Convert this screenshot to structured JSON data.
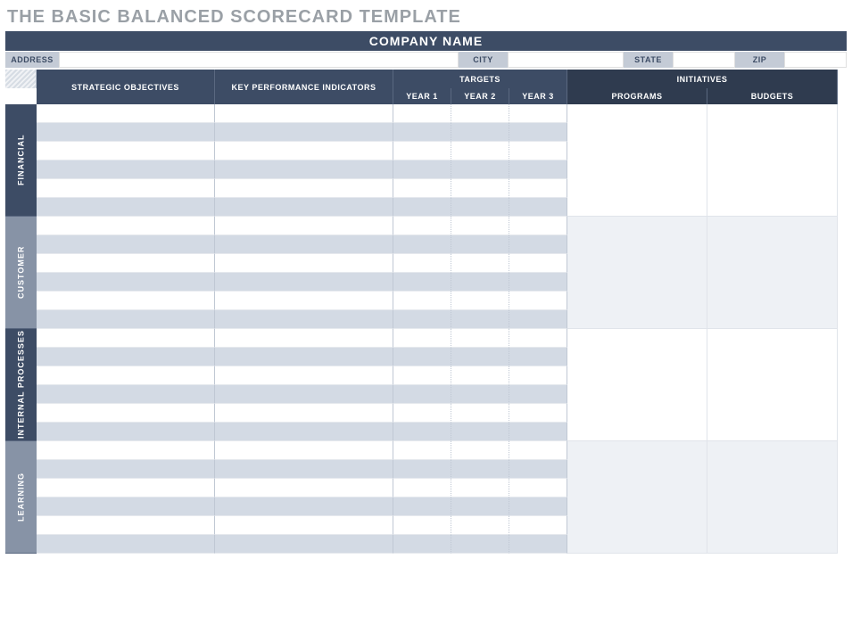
{
  "title": "THE BASIC BALANCED SCORECARD TEMPLATE",
  "company_name": "COMPANY NAME",
  "addr": {
    "address_lbl": "ADDRESS",
    "city_lbl": "CITY",
    "state_lbl": "STATE",
    "zip_lbl": "ZIP",
    "address": "",
    "city": "",
    "state": "",
    "zip": ""
  },
  "headers": {
    "strategic": "STRATEGIC OBJECTIVES",
    "kpi": "KEY PERFORMANCE INDICATORS",
    "targets": "TARGETS",
    "year1": "YEAR 1",
    "year2": "YEAR 2",
    "year3": "YEAR 3",
    "initiatives": "INITIATIVES",
    "programs": "PROGRAMS",
    "budgets": "BUDGETS"
  },
  "categories": {
    "financial": "FINANCIAL",
    "customer": "CUSTOMER",
    "internal": "INTERNAL PROCESSES",
    "learning": "LEARNING"
  }
}
